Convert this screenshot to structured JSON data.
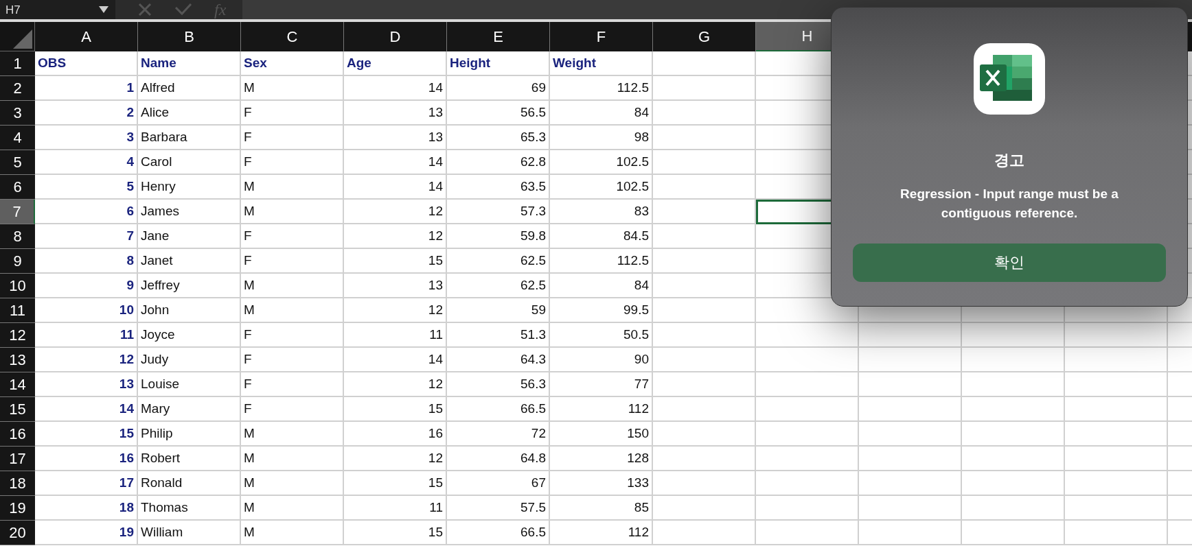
{
  "formula_bar": {
    "name_box": "H7",
    "function_label": "fx"
  },
  "columns": [
    {
      "label": "A",
      "selected": false
    },
    {
      "label": "B",
      "selected": false
    },
    {
      "label": "C",
      "selected": false
    },
    {
      "label": "D",
      "selected": false
    },
    {
      "label": "E",
      "selected": false
    },
    {
      "label": "F",
      "selected": false
    },
    {
      "label": "G",
      "selected": false
    },
    {
      "label": "H",
      "selected": true
    }
  ],
  "rows": [
    {
      "number": "1",
      "selected": false,
      "kind": "header",
      "cells": [
        "OBS",
        "Name",
        "Sex",
        "Age",
        "Height",
        "Weight"
      ]
    },
    {
      "number": "2",
      "selected": false,
      "kind": "data",
      "cells": [
        "1",
        "Alfred",
        "M",
        "14",
        "69",
        "112.5"
      ]
    },
    {
      "number": "3",
      "selected": false,
      "kind": "data",
      "cells": [
        "2",
        "Alice",
        "F",
        "13",
        "56.5",
        "84"
      ]
    },
    {
      "number": "4",
      "selected": false,
      "kind": "data",
      "cells": [
        "3",
        "Barbara",
        "F",
        "13",
        "65.3",
        "98"
      ]
    },
    {
      "number": "5",
      "selected": false,
      "kind": "data",
      "cells": [
        "4",
        "Carol",
        "F",
        "14",
        "62.8",
        "102.5"
      ]
    },
    {
      "number": "6",
      "selected": false,
      "kind": "data",
      "cells": [
        "5",
        "Henry",
        "M",
        "14",
        "63.5",
        "102.5"
      ]
    },
    {
      "number": "7",
      "selected": true,
      "kind": "data",
      "cells": [
        "6",
        "James",
        "M",
        "12",
        "57.3",
        "83"
      ]
    },
    {
      "number": "8",
      "selected": false,
      "kind": "data",
      "cells": [
        "7",
        "Jane",
        "F",
        "12",
        "59.8",
        "84.5"
      ]
    },
    {
      "number": "9",
      "selected": false,
      "kind": "data",
      "cells": [
        "8",
        "Janet",
        "F",
        "15",
        "62.5",
        "112.5"
      ]
    },
    {
      "number": "10",
      "selected": false,
      "kind": "data",
      "cells": [
        "9",
        "Jeffrey",
        "M",
        "13",
        "62.5",
        "84"
      ]
    },
    {
      "number": "11",
      "selected": false,
      "kind": "data",
      "cells": [
        "10",
        "John",
        "M",
        "12",
        "59",
        "99.5"
      ]
    },
    {
      "number": "12",
      "selected": false,
      "kind": "data",
      "cells": [
        "11",
        "Joyce",
        "F",
        "11",
        "51.3",
        "50.5"
      ]
    },
    {
      "number": "13",
      "selected": false,
      "kind": "data",
      "cells": [
        "12",
        "Judy",
        "F",
        "14",
        "64.3",
        "90"
      ]
    },
    {
      "number": "14",
      "selected": false,
      "kind": "data",
      "cells": [
        "13",
        "Louise",
        "F",
        "12",
        "56.3",
        "77"
      ]
    },
    {
      "number": "15",
      "selected": false,
      "kind": "data",
      "cells": [
        "14",
        "Mary",
        "F",
        "15",
        "66.5",
        "112"
      ]
    },
    {
      "number": "16",
      "selected": false,
      "kind": "data",
      "cells": [
        "15",
        "Philip",
        "M",
        "16",
        "72",
        "150"
      ]
    },
    {
      "number": "17",
      "selected": false,
      "kind": "data",
      "cells": [
        "16",
        "Robert",
        "M",
        "12",
        "64.8",
        "128"
      ]
    },
    {
      "number": "18",
      "selected": false,
      "kind": "data",
      "cells": [
        "17",
        "Ronald",
        "M",
        "15",
        "67",
        "133"
      ]
    },
    {
      "number": "19",
      "selected": false,
      "kind": "data",
      "cells": [
        "18",
        "Thomas",
        "M",
        "11",
        "57.5",
        "85"
      ]
    },
    {
      "number": "20",
      "selected": false,
      "kind": "data",
      "cells": [
        "19",
        "William",
        "M",
        "15",
        "66.5",
        "112"
      ]
    }
  ],
  "dialog": {
    "title": "경고",
    "message": "Regression - Input range must be a contiguous reference.",
    "button": "확인"
  }
}
